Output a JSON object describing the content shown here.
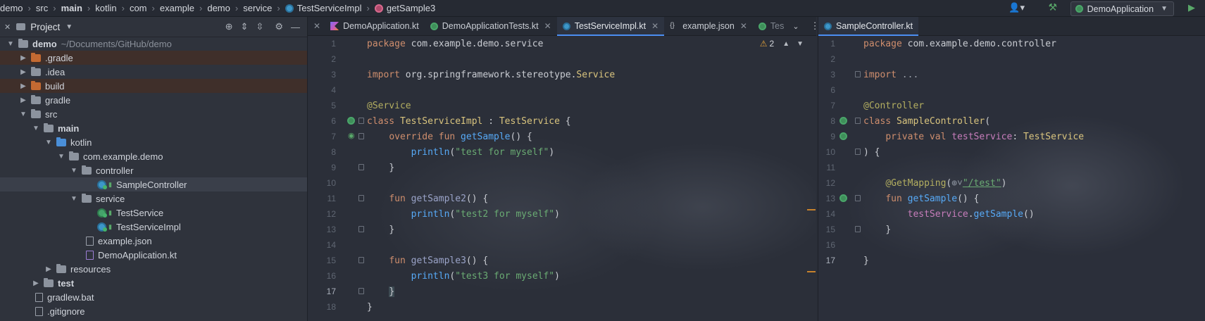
{
  "breadcrumb": [
    "demo",
    "src",
    "main",
    "kotlin",
    "com",
    "example",
    "demo",
    "service",
    "TestServiceImpl",
    "getSample3"
  ],
  "toolbar": {
    "run_config": "DemoApplication"
  },
  "project": {
    "title": "Project",
    "tree": [
      {
        "label": "demo",
        "extra": "~/Documents/GitHub/demo",
        "icon": "folder-grey"
      },
      {
        "label": ".gradle",
        "icon": "folder-orange"
      },
      {
        "label": ".idea",
        "icon": "folder-grey"
      },
      {
        "label": "build",
        "icon": "folder-orange"
      },
      {
        "label": "gradle",
        "icon": "folder-grey"
      },
      {
        "label": "src",
        "icon": "folder-grey"
      },
      {
        "label": "main",
        "icon": "folder-grey"
      },
      {
        "label": "kotlin",
        "icon": "folder-blue"
      },
      {
        "label": "com.example.demo",
        "icon": "folder-grey"
      },
      {
        "label": "controller",
        "icon": "folder-grey"
      },
      {
        "label": "SampleController",
        "icon": "kotlin-class-icon"
      },
      {
        "label": "service",
        "icon": "folder-grey"
      },
      {
        "label": "TestService",
        "icon": "kotlin-interface-icon"
      },
      {
        "label": "TestServiceImpl",
        "icon": "kotlin-class-icon"
      },
      {
        "label": "example.json",
        "icon": "json-file-icon"
      },
      {
        "label": "DemoApplication.kt",
        "icon": "kotlin-file-icon"
      },
      {
        "label": "resources",
        "icon": "folder-grey"
      },
      {
        "label": "test",
        "icon": "folder-grey"
      },
      {
        "label": "gradlew.bat",
        "icon": "file-icon"
      },
      {
        "label": ".gitignore",
        "icon": "file-icon"
      }
    ]
  },
  "left_editor": {
    "tabs": [
      "DemoApplication.kt",
      "DemoApplicationTests.kt",
      "TestServiceImpl.kt",
      "example.json",
      "Tes"
    ],
    "warnings": "2",
    "lines": [
      "1",
      "2",
      "3",
      "4",
      "5",
      "6",
      "7",
      "8",
      "9",
      "10",
      "11",
      "12",
      "13",
      "14",
      "15",
      "16",
      "17",
      "18"
    ],
    "code": {
      "l1_kw": "package",
      "l1_rest": " com.example.demo.service",
      "l3_kw": "import",
      "l3_rest": " org.springframework.stereotype.",
      "l3_cls": "Service",
      "l5_ann": "@Service",
      "l6_kw": "class",
      "l6_cls": " TestServiceImpl",
      "l6_colon": " : ",
      "l6_iface": "TestService",
      "l6_end": " {",
      "l7_kw": "override fun",
      "l7_fn": " getSample",
      "l7_end": "() {",
      "l8_fn": "println",
      "l8_p1": "(",
      "l8_str": "\"test for myself\"",
      "l8_p2": ")",
      "l9": "}",
      "l11_kw": "fun",
      "l11_fn": " getSample2",
      "l11_end": "() {",
      "l12_fn": "println",
      "l12_p1": "(",
      "l12_str": "\"test2 for myself\"",
      "l12_p2": ")",
      "l13": "}",
      "l15_kw": "fun",
      "l15_fn": " getSample3",
      "l15_end": "() {",
      "l16_fn": "println",
      "l16_p1": "(",
      "l16_str": "\"test3 for myself\"",
      "l16_p2": ")",
      "l17": "}",
      "l18": "}"
    }
  },
  "right_editor": {
    "tabs": [
      "SampleController.kt"
    ],
    "lines": [
      "1",
      "2",
      "3",
      "6",
      "7",
      "8",
      "9",
      "10",
      "11",
      "12",
      "13",
      "14",
      "15",
      "16",
      "17"
    ],
    "code": {
      "l1_kw": "package",
      "l1_rest": " com.example.demo.controller",
      "l3_kw": "import",
      "l3_rest": " ...",
      "l7_ann": "@Controller",
      "l8_kw": "class",
      "l8_cls": " SampleController",
      "l8_end": "(",
      "l9_kw": "private val",
      "l9_prop": " testService",
      "l9_colon": ": ",
      "l9_cls": "TestService",
      "l10": ") {",
      "l12_ann": "@GetMapping",
      "l12_p1": "(",
      "l12_globe": "⊕˅",
      "l12_str": "\"/test\"",
      "l12_p2": ")",
      "l13_kw": "fun",
      "l13_fn": " getSample",
      "l13_end": "() {",
      "l14_prop": "testService",
      "l14_dot": ".",
      "l14_fn": "getSample",
      "l14_end": "()",
      "l15": "}",
      "l17": "}"
    }
  }
}
